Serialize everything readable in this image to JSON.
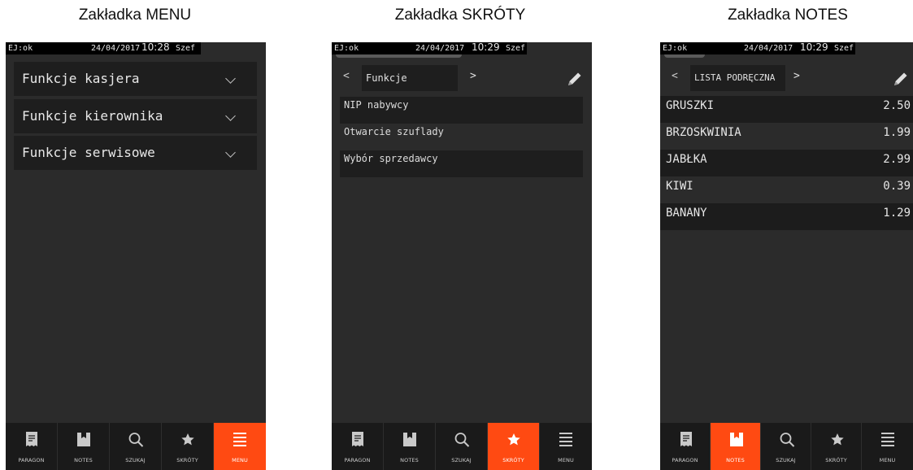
{
  "captions": [
    "Zakładka MENU",
    "Zakładka SKRÓTY",
    "Zakładka NOTES"
  ],
  "screens": [
    {
      "status": {
        "left": "EJ:ok",
        "date": "24/04/2017",
        "time": "10:28",
        "user": "Szef"
      },
      "menu_items": [
        "Funkcje kasjera",
        "Funkcje kierownika",
        "Funkcje serwisowe"
      ],
      "active_tab": "MENU"
    },
    {
      "status": {
        "left": "EJ:ok",
        "date": "24/04/2017",
        "time": "10:29",
        "user": "Szef"
      },
      "header": {
        "prev": "<",
        "title": "Funkcje",
        "next": ">"
      },
      "shortcuts": [
        "NIP nabywcy",
        "Otwarcie szuflady",
        "Wybór sprzedawcy"
      ],
      "active_tab": "SKRÓTY"
    },
    {
      "status": {
        "left": "EJ:ok",
        "date": "24/04/2017",
        "time": "10:29",
        "user": "Szef"
      },
      "header": {
        "prev": "<",
        "title": "LISTA PODRĘCZNA",
        "next": ">"
      },
      "notes": [
        {
          "name": "GRUSZKI",
          "price": "2.50"
        },
        {
          "name": "BRZOSKWINIA",
          "price": "1.99"
        },
        {
          "name": "JABŁKA",
          "price": "2.99"
        },
        {
          "name": "KIWI",
          "price": "0.39"
        },
        {
          "name": "BANANY",
          "price": "1.29"
        }
      ],
      "active_tab": "NOTES"
    }
  ],
  "nav": [
    {
      "label": "PARAGON",
      "icon": "receipt-icon"
    },
    {
      "label": "NOTES",
      "icon": "notes-icon"
    },
    {
      "label": "SZUKAJ",
      "icon": "search-icon"
    },
    {
      "label": "SKRÓTY",
      "icon": "star-icon"
    },
    {
      "label": "MENU",
      "icon": "menu-icon"
    }
  ],
  "colors": {
    "accent": "#ff4a12",
    "background": "#2b2b2b",
    "row_dark": "#1e1e1e"
  }
}
